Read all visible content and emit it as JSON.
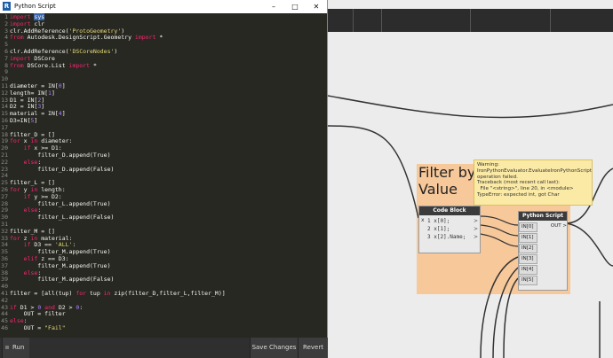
{
  "window": {
    "title": "Python Script",
    "logo": "R"
  },
  "code_lines": [
    [
      {
        "t": "import ",
        "c": "kw"
      },
      {
        "t": "sys",
        "c": "sel"
      }
    ],
    [
      {
        "t": "import ",
        "c": "kw"
      },
      {
        "t": "clr"
      }
    ],
    [
      {
        "t": "clr.AddReference("
      },
      {
        "t": "'ProtoGeometry'",
        "c": "st"
      },
      {
        "t": ")"
      }
    ],
    [
      {
        "t": "from ",
        "c": "kw"
      },
      {
        "t": "Autodesk.DesignScript.Geometry "
      },
      {
        "t": "import ",
        "c": "kw"
      },
      {
        "t": "*"
      }
    ],
    [],
    [
      {
        "t": "clr.AddReference("
      },
      {
        "t": "'DSCoreNodes'",
        "c": "st"
      },
      {
        "t": ")"
      }
    ],
    [
      {
        "t": "import ",
        "c": "kw"
      },
      {
        "t": "DSCore"
      }
    ],
    [
      {
        "t": "from ",
        "c": "kw"
      },
      {
        "t": "DSCore.List "
      },
      {
        "t": "import ",
        "c": "kw"
      },
      {
        "t": "*"
      }
    ],
    [],
    [],
    [
      {
        "t": "diameter = IN["
      },
      {
        "t": "0",
        "c": "nm"
      },
      {
        "t": "]"
      }
    ],
    [
      {
        "t": "length= IN["
      },
      {
        "t": "1",
        "c": "nm"
      },
      {
        "t": "]"
      }
    ],
    [
      {
        "t": "D1 = IN["
      },
      {
        "t": "2",
        "c": "nm"
      },
      {
        "t": "]"
      }
    ],
    [
      {
        "t": "D2 = IN["
      },
      {
        "t": "3",
        "c": "nm"
      },
      {
        "t": "]"
      }
    ],
    [
      {
        "t": "material = IN["
      },
      {
        "t": "4",
        "c": "nm"
      },
      {
        "t": "]"
      }
    ],
    [
      {
        "t": "D3=IN["
      },
      {
        "t": "5",
        "c": "nm"
      },
      {
        "t": "]"
      }
    ],
    [],
    [
      {
        "t": "filter_D = []"
      }
    ],
    [
      {
        "t": "for ",
        "c": "kw"
      },
      {
        "t": "x "
      },
      {
        "t": "in ",
        "c": "kw"
      },
      {
        "t": "diameter:"
      }
    ],
    [
      {
        "t": "    "
      },
      {
        "t": "if ",
        "c": "kw"
      },
      {
        "t": "x >= D1:"
      }
    ],
    [
      {
        "t": "        filter_D.append(True)"
      }
    ],
    [
      {
        "t": "    "
      },
      {
        "t": "else",
        "c": "kw"
      },
      {
        "t": ":"
      }
    ],
    [
      {
        "t": "        filter_D.append(False)"
      }
    ],
    [],
    [
      {
        "t": "filter_L = []"
      }
    ],
    [
      {
        "t": "for ",
        "c": "kw"
      },
      {
        "t": "y "
      },
      {
        "t": "in ",
        "c": "kw"
      },
      {
        "t": "length:"
      }
    ],
    [
      {
        "t": "    "
      },
      {
        "t": "if ",
        "c": "kw"
      },
      {
        "t": "y >= D2:"
      }
    ],
    [
      {
        "t": "        filter_L.append(True)"
      }
    ],
    [
      {
        "t": "    "
      },
      {
        "t": "else",
        "c": "kw"
      },
      {
        "t": ":"
      }
    ],
    [
      {
        "t": "        filter_L.append(False)"
      }
    ],
    [],
    [
      {
        "t": "filter_M = []"
      }
    ],
    [
      {
        "t": "for ",
        "c": "kw"
      },
      {
        "t": "z "
      },
      {
        "t": "in ",
        "c": "kw"
      },
      {
        "t": "material:"
      }
    ],
    [
      {
        "t": "    "
      },
      {
        "t": "if ",
        "c": "kw"
      },
      {
        "t": "D3 == "
      },
      {
        "t": "'ALL'",
        "c": "st"
      },
      {
        "t": ":"
      }
    ],
    [
      {
        "t": "        filter_M.append(True)"
      }
    ],
    [
      {
        "t": "    "
      },
      {
        "t": "elif ",
        "c": "kw"
      },
      {
        "t": "z == D3:"
      }
    ],
    [
      {
        "t": "        filter_M.append(True)"
      }
    ],
    [
      {
        "t": "    "
      },
      {
        "t": "else",
        "c": "kw"
      },
      {
        "t": ":"
      }
    ],
    [
      {
        "t": "        filter_M.append(False)"
      }
    ],
    [],
    [
      {
        "t": "filter = [all(tup) "
      },
      {
        "t": "for ",
        "c": "kw"
      },
      {
        "t": "tup "
      },
      {
        "t": "in ",
        "c": "kw"
      },
      {
        "t": "zip(filter_D,filter_L,filter_M)]"
      }
    ],
    [],
    [
      {
        "t": "if ",
        "c": "kw"
      },
      {
        "t": "D1 > "
      },
      {
        "t": "0",
        "c": "nm"
      },
      {
        "t": " "
      },
      {
        "t": "and ",
        "c": "kw"
      },
      {
        "t": "D2 > "
      },
      {
        "t": "0",
        "c": "nm"
      },
      {
        "t": ":"
      }
    ],
    [
      {
        "t": "    OUT = filter"
      }
    ],
    [
      {
        "t": "else",
        "c": "kw"
      },
      {
        "t": ":"
      }
    ],
    [
      {
        "t": "    OUT = "
      },
      {
        "t": "\"Fail\"",
        "c": "st"
      }
    ]
  ],
  "footer": {
    "run_label": "Run",
    "save_label": "Save Changes",
    "revert_label": "Revert"
  },
  "canvas": {
    "group_title_1": "Filter by pa",
    "group_title_2": "Value",
    "code_block": {
      "title": "Code Block",
      "lines": [
        "x[0];",
        "x[1];",
        "x[2].Name;"
      ],
      "line_numbers": [
        "1",
        "2",
        "3"
      ],
      "input_port": "x",
      "output_port": ">"
    },
    "python_node": {
      "title": "Python Script",
      "inputs": [
        "IN[0]",
        "IN[1]",
        "IN[2]",
        "IN[3]",
        "IN[4]",
        "IN[5]"
      ],
      "output": "OUT"
    },
    "warning": [
      "Warning:",
      "IronPythonEvaluator.EvaluateIronPythonScript",
      "operation failed.",
      "Traceback (most recent call last):",
      "  File \"<string>\", line 20, in <module>",
      "TypeError: expected int, got Char"
    ]
  },
  "colors": {
    "editor_bg": "#272822",
    "keyword": "#f92672",
    "string": "#e6db74",
    "number": "#ae81ff",
    "group": "#f7c89a",
    "warning": "#fbeaa5"
  }
}
